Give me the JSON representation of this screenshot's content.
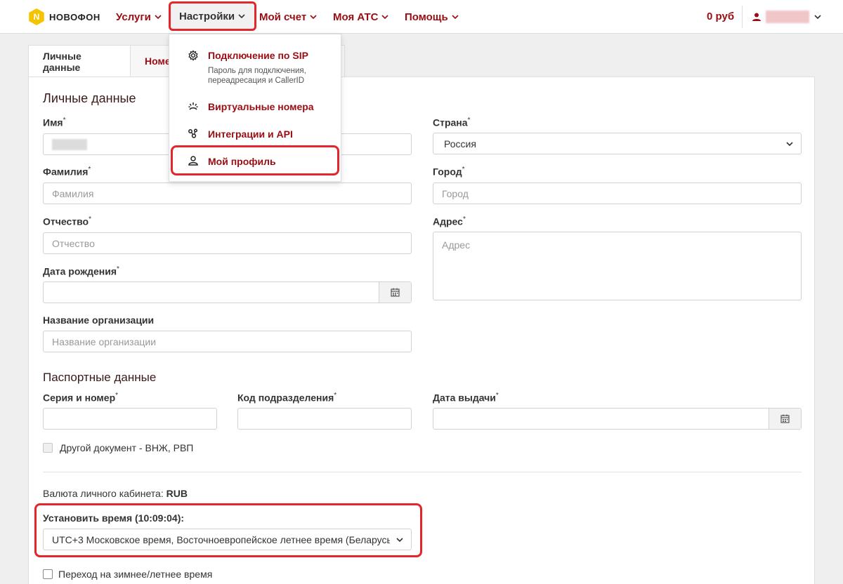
{
  "brand": {
    "logo_letter": "N",
    "name": "НОВОФОН"
  },
  "nav": {
    "items": [
      {
        "label": "Услуги"
      },
      {
        "label": "Настройки"
      },
      {
        "label": "Мой счет"
      },
      {
        "label": "Моя АТС"
      },
      {
        "label": "Помощь"
      }
    ],
    "balance": "0 руб"
  },
  "tabs": [
    {
      "label": "Личные данные",
      "active": true
    },
    {
      "label": "Номе",
      "active": false
    }
  ],
  "dropdown": {
    "items": [
      {
        "title": "Подключение по SIP",
        "subtitle": "Пароль для подключения, переадресация и CallerID",
        "icon": "gear-icon"
      },
      {
        "title": "Виртуальные номера",
        "icon": "phone-signal-icon"
      },
      {
        "title": "Интеграции и API",
        "icon": "integrations-icon"
      },
      {
        "title": "Мой профиль",
        "icon": "user-icon",
        "highlighted": true
      }
    ]
  },
  "personal": {
    "title": "Личные данные",
    "first_name": {
      "label": "Имя"
    },
    "last_name": {
      "label": "Фамилия",
      "placeholder": "Фамилия"
    },
    "middle_name": {
      "label": "Отчество",
      "placeholder": "Отчество"
    },
    "birth_date": {
      "label": "Дата рождения"
    },
    "org_name": {
      "label": "Название организации",
      "placeholder": "Название организации"
    },
    "country": {
      "label": "Страна",
      "value": "Россия"
    },
    "city": {
      "label": "Город",
      "placeholder": "Город"
    },
    "address": {
      "label": "Адрес",
      "placeholder": "Адрес"
    },
    "required_mark": "*"
  },
  "passport": {
    "title": "Паспортные данные",
    "series_number": {
      "label": "Серия и номер"
    },
    "division_code": {
      "label": "Код подразделения"
    },
    "issue_date": {
      "label": "Дата выдачи"
    },
    "other_doc": {
      "label": "Другой документ - ВНЖ, РВП",
      "checked": false
    }
  },
  "settings": {
    "currency_label": "Валюта личного кабинета:",
    "currency_value": "RUB",
    "time_label": "Установить время (10:09:04):",
    "timezone_value": "UTC+3 Московское время, Восточноевропейское летнее время (Беларусь",
    "dst_label": "Переход на зимнее/летнее время",
    "dst_checked": false
  },
  "colors": {
    "accent": "#9b0c12",
    "highlight": "#e2262b",
    "logo": "#f5c400"
  }
}
